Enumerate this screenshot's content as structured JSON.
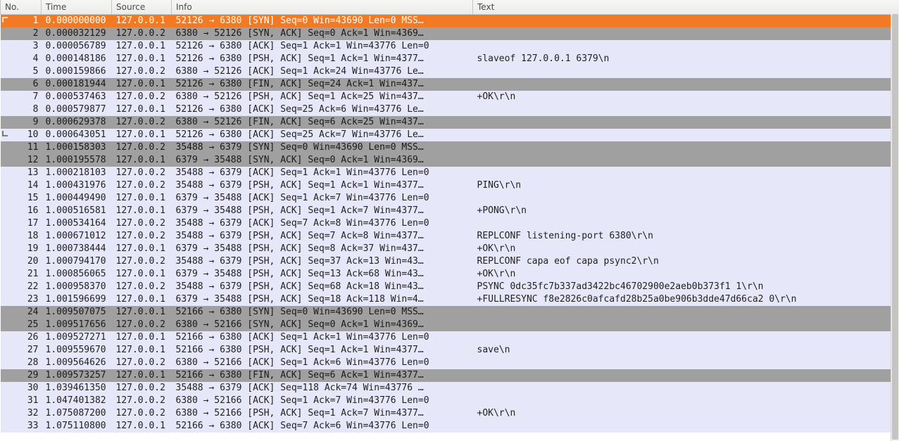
{
  "columns": {
    "no": "No.",
    "time": "Time",
    "source": "Source",
    "info": "Info",
    "text": "Text"
  },
  "rows": [
    {
      "no": "1",
      "time": "0.000000000",
      "src": "127.0.0.1",
      "info": "52126 → 6380 [SYN] Seq=0 Win=43690 Len=0 MSS…",
      "text": "",
      "style": "sel",
      "mark": "start"
    },
    {
      "no": "2",
      "time": "0.000032129",
      "src": "127.0.0.2",
      "info": "6380 → 52126 [SYN, ACK] Seq=0 Ack=1 Win=4369…",
      "text": "",
      "style": "gray"
    },
    {
      "no": "3",
      "time": "0.000056789",
      "src": "127.0.0.1",
      "info": "52126 → 6380 [ACK] Seq=1 Ack=1 Win=43776 Len=0",
      "text": "",
      "style": "light"
    },
    {
      "no": "4",
      "time": "0.000148186",
      "src": "127.0.0.1",
      "info": "52126 → 6380 [PSH, ACK] Seq=1 Ack=1 Win=4377…",
      "text": "slaveof 127.0.0.1 6379\\n",
      "style": "light"
    },
    {
      "no": "5",
      "time": "0.000159866",
      "src": "127.0.0.2",
      "info": "6380 → 52126 [ACK] Seq=1 Ack=24 Win=43776 Le…",
      "text": "",
      "style": "light"
    },
    {
      "no": "6",
      "time": "0.000181944",
      "src": "127.0.0.1",
      "info": "52126 → 6380 [FIN, ACK] Seq=24 Ack=1 Win=437…",
      "text": "",
      "style": "gray"
    },
    {
      "no": "7",
      "time": "0.000537463",
      "src": "127.0.0.2",
      "info": "6380 → 52126 [PSH, ACK] Seq=1 Ack=25 Win=437…",
      "text": "+OK\\r\\n",
      "style": "light"
    },
    {
      "no": "8",
      "time": "0.000579877",
      "src": "127.0.0.1",
      "info": "52126 → 6380 [ACK] Seq=25 Ack=6 Win=43776 Le…",
      "text": "",
      "style": "light"
    },
    {
      "no": "9",
      "time": "0.000629378",
      "src": "127.0.0.2",
      "info": "6380 → 52126 [FIN, ACK] Seq=6 Ack=25 Win=437…",
      "text": "",
      "style": "gray"
    },
    {
      "no": "10",
      "time": "0.000643051",
      "src": "127.0.0.1",
      "info": "52126 → 6380 [ACK] Seq=25 Ack=7 Win=43776 Le…",
      "text": "",
      "style": "light",
      "mark": "end"
    },
    {
      "no": "11",
      "time": "1.000158303",
      "src": "127.0.0.2",
      "info": "35488 → 6379 [SYN] Seq=0 Win=43690 Len=0 MSS…",
      "text": "",
      "style": "gray"
    },
    {
      "no": "12",
      "time": "1.000195578",
      "src": "127.0.0.1",
      "info": "6379 → 35488 [SYN, ACK] Seq=0 Ack=1 Win=4369…",
      "text": "",
      "style": "gray"
    },
    {
      "no": "13",
      "time": "1.000218103",
      "src": "127.0.0.2",
      "info": "35488 → 6379 [ACK] Seq=1 Ack=1 Win=43776 Len=0",
      "text": "",
      "style": "light"
    },
    {
      "no": "14",
      "time": "1.000431976",
      "src": "127.0.0.2",
      "info": "35488 → 6379 [PSH, ACK] Seq=1 Ack=1 Win=4377…",
      "text": "PING\\r\\n",
      "style": "light"
    },
    {
      "no": "15",
      "time": "1.000449490",
      "src": "127.0.0.1",
      "info": "6379 → 35488 [ACK] Seq=1 Ack=7 Win=43776 Len=0",
      "text": "",
      "style": "light"
    },
    {
      "no": "16",
      "time": "1.000516581",
      "src": "127.0.0.1",
      "info": "6379 → 35488 [PSH, ACK] Seq=1 Ack=7 Win=4377…",
      "text": "+PONG\\r\\n",
      "style": "light"
    },
    {
      "no": "17",
      "time": "1.000534164",
      "src": "127.0.0.2",
      "info": "35488 → 6379 [ACK] Seq=7 Ack=8 Win=43776 Len=0",
      "text": "",
      "style": "light"
    },
    {
      "no": "18",
      "time": "1.000671012",
      "src": "127.0.0.2",
      "info": "35488 → 6379 [PSH, ACK] Seq=7 Ack=8 Win=4377…",
      "text": "REPLCONF listening-port 6380\\r\\n",
      "style": "light"
    },
    {
      "no": "19",
      "time": "1.000738444",
      "src": "127.0.0.1",
      "info": "6379 → 35488 [PSH, ACK] Seq=8 Ack=37 Win=437…",
      "text": "+OK\\r\\n",
      "style": "light"
    },
    {
      "no": "20",
      "time": "1.000794170",
      "src": "127.0.0.2",
      "info": "35488 → 6379 [PSH, ACK] Seq=37 Ack=13 Win=43…",
      "text": "REPLCONF capa eof capa psync2\\r\\n",
      "style": "light"
    },
    {
      "no": "21",
      "time": "1.000856065",
      "src": "127.0.0.1",
      "info": "6379 → 35488 [PSH, ACK] Seq=13 Ack=68 Win=43…",
      "text": "+OK\\r\\n",
      "style": "light"
    },
    {
      "no": "22",
      "time": "1.000958370",
      "src": "127.0.0.2",
      "info": "35488 → 6379 [PSH, ACK] Seq=68 Ack=18 Win=43…",
      "text": "PSYNC 0dc35fc7b337ad3422bc46702900e2aeb0b373f1 1\\r\\n",
      "style": "light"
    },
    {
      "no": "23",
      "time": "1.001596699",
      "src": "127.0.0.1",
      "info": "6379 → 35488 [PSH, ACK] Seq=18 Ack=118 Win=4…",
      "text": "+FULLRESYNC f8e2826c0afcafd28b25a0be906b3dde47d66ca2 0\\r\\n",
      "style": "light"
    },
    {
      "no": "24",
      "time": "1.009507075",
      "src": "127.0.0.1",
      "info": "52166 → 6380 [SYN] Seq=0 Win=43690 Len=0 MSS…",
      "text": "",
      "style": "gray"
    },
    {
      "no": "25",
      "time": "1.009517656",
      "src": "127.0.0.2",
      "info": "6380 → 52166 [SYN, ACK] Seq=0 Ack=1 Win=4369…",
      "text": "",
      "style": "gray"
    },
    {
      "no": "26",
      "time": "1.009527271",
      "src": "127.0.0.1",
      "info": "52166 → 6380 [ACK] Seq=1 Ack=1 Win=43776 Len=0",
      "text": "",
      "style": "light"
    },
    {
      "no": "27",
      "time": "1.009559670",
      "src": "127.0.0.1",
      "info": "52166 → 6380 [PSH, ACK] Seq=1 Ack=1 Win=4377…",
      "text": "save\\n",
      "style": "light"
    },
    {
      "no": "28",
      "time": "1.009564626",
      "src": "127.0.0.2",
      "info": "6380 → 52166 [ACK] Seq=1 Ack=6 Win=43776 Len=0",
      "text": "",
      "style": "light"
    },
    {
      "no": "29",
      "time": "1.009573257",
      "src": "127.0.0.1",
      "info": "52166 → 6380 [FIN, ACK] Seq=6 Ack=1 Win=4377…",
      "text": "",
      "style": "gray"
    },
    {
      "no": "30",
      "time": "1.039461350",
      "src": "127.0.0.2",
      "info": "35488 → 6379 [ACK] Seq=118 Ack=74 Win=43776 …",
      "text": "",
      "style": "light"
    },
    {
      "no": "31",
      "time": "1.047401382",
      "src": "127.0.0.2",
      "info": "6380 → 52166 [ACK] Seq=1 Ack=7 Win=43776 Len=0",
      "text": "",
      "style": "light"
    },
    {
      "no": "32",
      "time": "1.075087200",
      "src": "127.0.0.2",
      "info": "6380 → 52166 [PSH, ACK] Seq=1 Ack=7 Win=4377…",
      "text": "+OK\\r\\n",
      "style": "light"
    },
    {
      "no": "33",
      "time": "1.075110800",
      "src": "127.0.0.1",
      "info": "52166 → 6380 [ACK] Seq=7 Ack=6 Win=43776 Len=0",
      "text": "",
      "style": "light"
    }
  ]
}
